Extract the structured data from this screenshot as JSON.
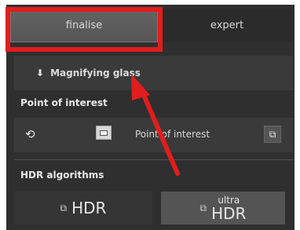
{
  "tabs": [
    {
      "label": "finalise",
      "selected": true
    },
    {
      "label": "expert",
      "selected": false
    }
  ],
  "magnifying_glass": {
    "icon": "arrow-down-icon",
    "label": "Magnifying glass"
  },
  "point_of_interest": {
    "title": "Point of interest",
    "sync_icon": "sync-icon",
    "toggle_icon": "toggle-icon",
    "label": "Point of interest",
    "copy_icon": "copy-icon"
  },
  "hdr_algorithms": {
    "title": "HDR algorithms",
    "buttons": [
      {
        "label": "HDR",
        "icon": "layers-icon",
        "selected": false
      },
      {
        "prefix": "ultra",
        "label": "HDR",
        "icon": "layers-icon",
        "selected": true
      }
    ]
  },
  "annotation": {
    "highlight_color": "#e21d1d",
    "arrow_color": "#e21d1d"
  }
}
